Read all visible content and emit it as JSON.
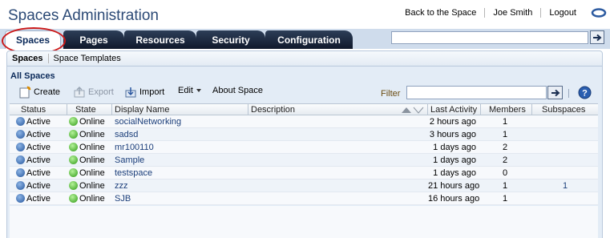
{
  "header": {
    "title": "Spaces Administration",
    "links": [
      "Back to the Space",
      "Joe Smith",
      "Logout"
    ],
    "logo_icon": "oracle-logo-icon"
  },
  "tabs": [
    {
      "label": "Spaces",
      "active": true
    },
    {
      "label": "Pages",
      "active": false
    },
    {
      "label": "Resources",
      "active": false
    },
    {
      "label": "Security",
      "active": false
    },
    {
      "label": "Configuration",
      "active": false
    }
  ],
  "subtabs": [
    {
      "label": "Spaces",
      "active": true
    },
    {
      "label": "Space Templates",
      "active": false
    }
  ],
  "panel": {
    "title": "All Spaces",
    "toolbar": {
      "create": "Create",
      "export": "Export",
      "import": "Import",
      "edit": "Edit",
      "about": "About Space",
      "filter_label": "Filter"
    }
  },
  "table": {
    "columns": [
      "Status",
      "State",
      "Display Name",
      "Description",
      "Last Activity",
      "Members",
      "Subspaces"
    ],
    "rows": [
      {
        "status": "Active",
        "state": "Online",
        "name": "socialNetworking",
        "description": "",
        "last_activity": "2 hours ago",
        "members": "1",
        "subspaces": ""
      },
      {
        "status": "Active",
        "state": "Online",
        "name": "sadsd",
        "description": "",
        "last_activity": "3 hours ago",
        "members": "1",
        "subspaces": ""
      },
      {
        "status": "Active",
        "state": "Online",
        "name": "mr100110",
        "description": "",
        "last_activity": "1 days ago",
        "members": "2",
        "subspaces": ""
      },
      {
        "status": "Active",
        "state": "Online",
        "name": "Sample",
        "description": "",
        "last_activity": "1 days ago",
        "members": "2",
        "subspaces": ""
      },
      {
        "status": "Active",
        "state": "Online",
        "name": "testspace",
        "description": "",
        "last_activity": "1 days ago",
        "members": "0",
        "subspaces": ""
      },
      {
        "status": "Active",
        "state": "Online",
        "name": "zzz",
        "description": "",
        "last_activity": "21 hours ago",
        "members": "1",
        "subspaces": "1"
      },
      {
        "status": "Active",
        "state": "Online",
        "name": "SJB",
        "description": "",
        "last_activity": "16 hours ago",
        "members": "1",
        "subspaces": ""
      }
    ]
  },
  "colors": {
    "title": "#2c4a76",
    "tab_dark": "#10192b",
    "panel_bg": "#e3ecf6",
    "link": "#1b3e7a",
    "highlight_ring": "#cc1a1a"
  }
}
